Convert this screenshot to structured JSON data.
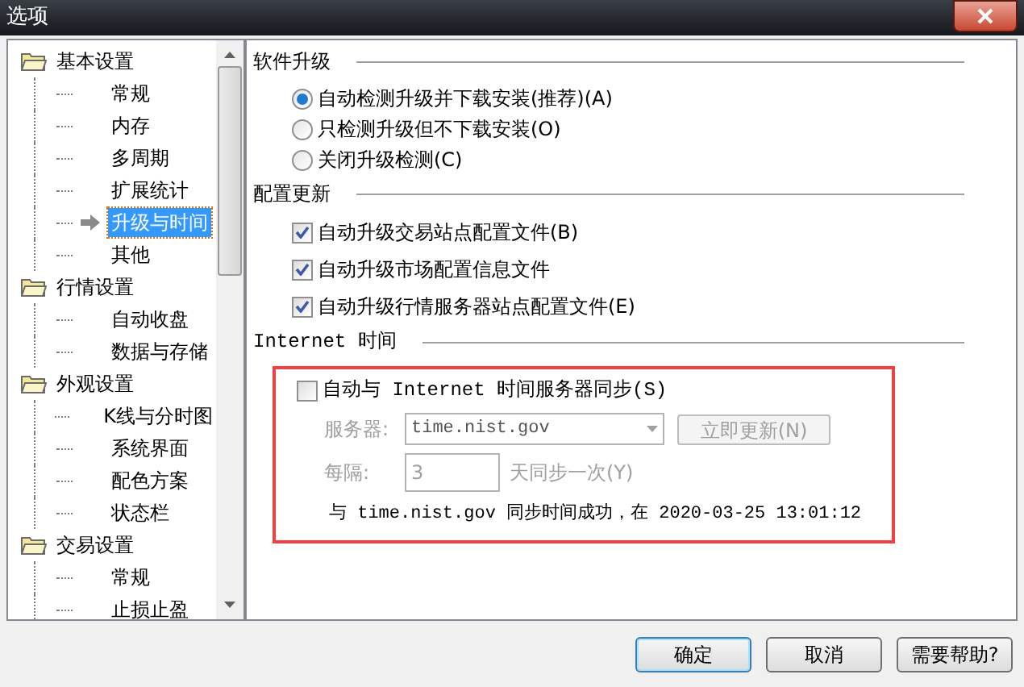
{
  "window": {
    "title": "选项"
  },
  "tree": [
    {
      "label": "基本设置",
      "children": [
        {
          "label": "常规",
          "selected": false
        },
        {
          "label": "内存",
          "selected": false
        },
        {
          "label": "多周期",
          "selected": false
        },
        {
          "label": "扩展统计",
          "selected": false
        },
        {
          "label": "升级与时间",
          "selected": true
        },
        {
          "label": "其他",
          "selected": false
        }
      ]
    },
    {
      "label": "行情设置",
      "children": [
        {
          "label": "自动收盘",
          "selected": false
        },
        {
          "label": "数据与存储",
          "selected": false
        }
      ]
    },
    {
      "label": "外观设置",
      "children": [
        {
          "label": "K线与分时图",
          "selected": false
        },
        {
          "label": "系统界面",
          "selected": false
        },
        {
          "label": "配色方案",
          "selected": false
        },
        {
          "label": "状态栏",
          "selected": false
        }
      ]
    },
    {
      "label": "交易设置",
      "children": [
        {
          "label": "常规",
          "selected": false
        },
        {
          "label": "止损止盈",
          "selected": false
        }
      ]
    }
  ],
  "software_upgrade": {
    "title": "软件升级",
    "options": [
      {
        "label": "自动检测升级并下载安装(推荐)(A)",
        "selected": true
      },
      {
        "label": "只检测升级但不下载安装(O)",
        "selected": false
      },
      {
        "label": "关闭升级检测(C)",
        "selected": false
      }
    ]
  },
  "config_update": {
    "title": "配置更新",
    "options": [
      {
        "label": "自动升级交易站点配置文件(B)",
        "checked": true
      },
      {
        "label": "自动升级市场配置信息文件",
        "checked": true
      },
      {
        "label": "自动升级行情服务器站点配置文件(E)",
        "checked": true
      }
    ]
  },
  "internet_time": {
    "title": "Internet 时间",
    "sync": {
      "label": "自动与 Internet 时间服务器同步(S)",
      "checked": false
    },
    "server_label": "服务器:",
    "server": "time.nist.gov",
    "update_button": "立即更新(N)",
    "interval_label": "每隔:",
    "interval": "3",
    "interval_unit": "天同步一次(Y)",
    "disabled": true,
    "status": "与 time.nist.gov 同步时间成功，在 2020-03-25 13:01:12",
    "highlighted": true
  },
  "buttons": [
    {
      "label": "确定",
      "default": true
    },
    {
      "label": "取消",
      "default": false
    },
    {
      "label": "需要帮助?",
      "default": false
    }
  ]
}
